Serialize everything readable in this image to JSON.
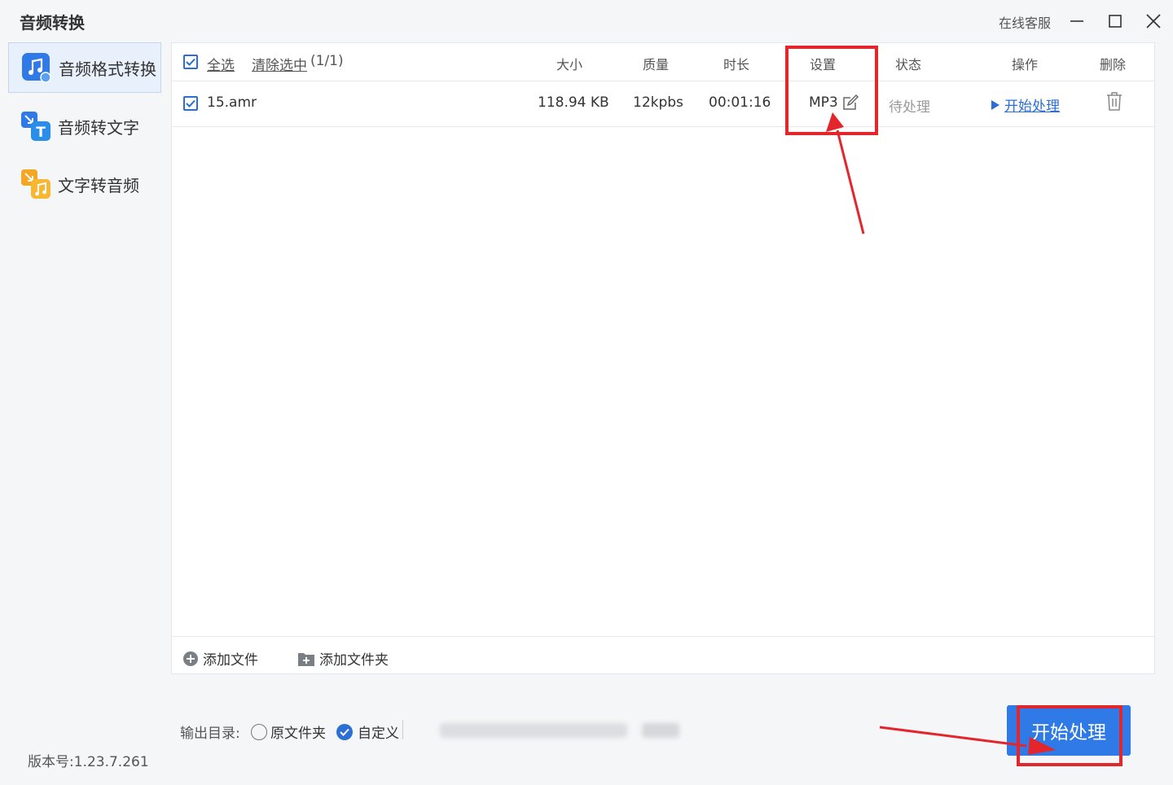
{
  "titlebar": {
    "title": "音频转换",
    "support": "在线客服"
  },
  "sidebar": {
    "items": [
      {
        "label": "音频格式转换",
        "active": true,
        "icon": "music-note-icon"
      },
      {
        "label": "音频转文字",
        "active": false,
        "icon": "text-convert-icon"
      },
      {
        "label": "文字转音频",
        "active": false,
        "icon": "audio-convert-icon"
      }
    ],
    "version": "版本号:1.23.7.261"
  },
  "table": {
    "select_all": "全选",
    "clear_selected": "清除选中",
    "count": "(1/1)",
    "columns": {
      "size": "大小",
      "quality": "质量",
      "duration": "时长",
      "settings": "设置",
      "status": "状态",
      "action": "操作",
      "delete": "删除"
    },
    "rows": [
      {
        "checked": true,
        "name": "15.amr",
        "size": "118.94 KB",
        "quality": "12kpbs",
        "duration": "00:01:16",
        "format": "MP3",
        "status": "待处理",
        "action": "开始处理"
      }
    ]
  },
  "bottom": {
    "add_file": "添加文件",
    "add_folder": "添加文件夹"
  },
  "output": {
    "label": "输出目录:",
    "option_original": "原文件夹",
    "option_custom": "自定义",
    "selected": "自定义"
  },
  "start_button": "开始处理",
  "colors": {
    "accent": "#2f7ae6",
    "highlight": "#e3262c"
  }
}
